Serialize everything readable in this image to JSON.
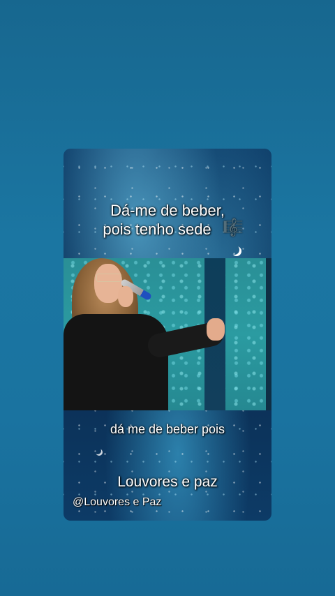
{
  "lyric_top": {
    "line1": "Dá-me de beber,",
    "line2": "pois tenho sede",
    "icon": "music-notes-icon"
  },
  "lyric_bottom": "dá me de beber pois",
  "channel_title": "Louvores e paz",
  "handle": "@Louvores e Paz",
  "colors": {
    "background": "#1a73a0",
    "text": "#ffffff"
  }
}
